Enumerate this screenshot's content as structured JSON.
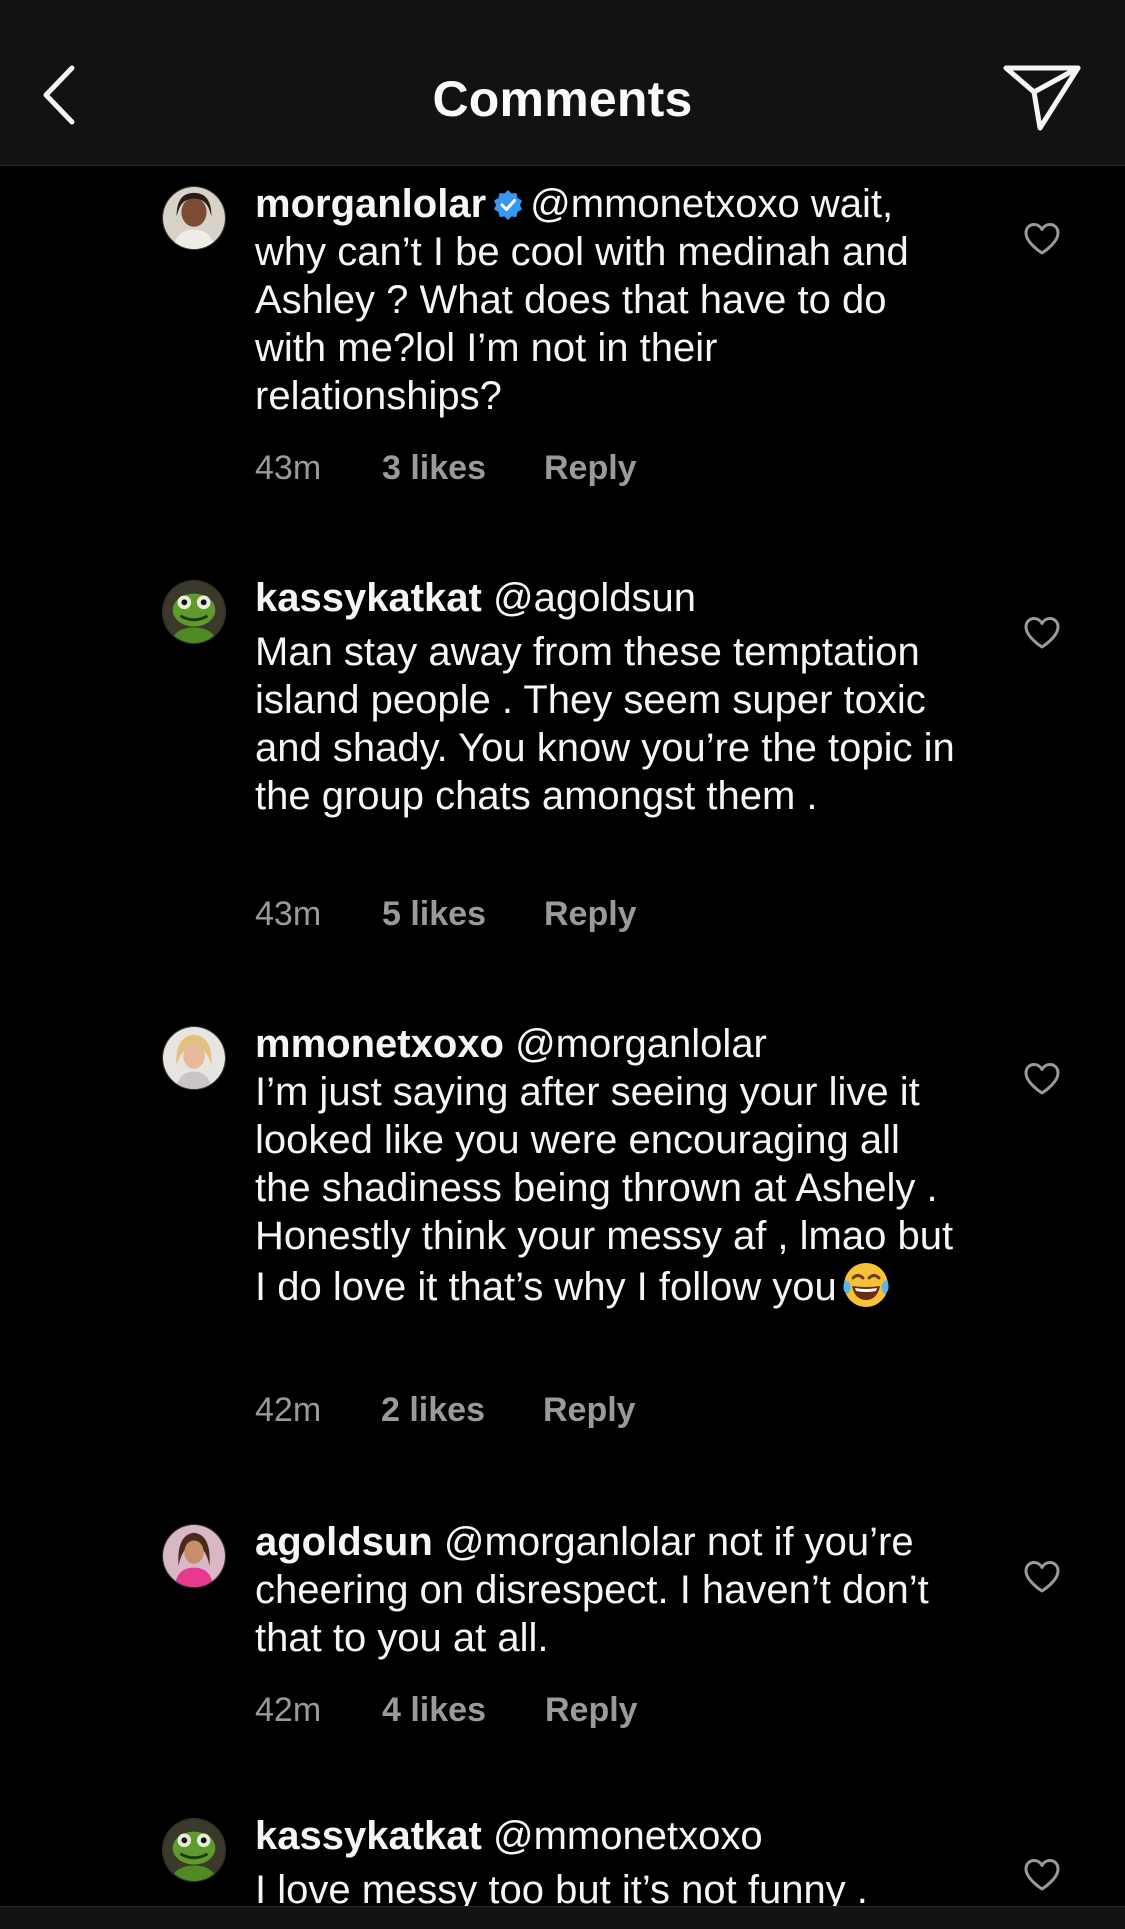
{
  "header": {
    "title": "Comments",
    "back_icon": "chevron-left-icon",
    "share_icon": "send-icon"
  },
  "comments": [
    {
      "username": "morganlolar",
      "verified": true,
      "mention": "@mmonetxoxo",
      "text": " wait, why can’t I be cool with medinah and Ashley ? What does that have to do with me?lol I’m not in their relationships?",
      "time": "43m",
      "likes": "3 likes",
      "reply": "Reply"
    },
    {
      "username": "kassykatkat",
      "mention": "@agoldsun",
      "text": "Man stay away from these temptation island people . They seem super toxic and shady.  You know you’re the topic in the group chats amongst them .",
      "time": "43m",
      "likes": "5 likes",
      "reply": "Reply"
    },
    {
      "username": "mmonetxoxo",
      "mention": "@morganlolar",
      "text": "I’m just saying after seeing your live it looked like you were encouraging all the shadiness being thrown at Ashely . Honestly think your messy af , lmao but I do love it that’s why I follow you",
      "emoji": "face-with-tears-of-joy",
      "time": "42m",
      "likes": "2 likes",
      "reply": "Reply"
    },
    {
      "username": "agoldsun",
      "mention": "@morganlolar",
      "text": " not if you’re cheering on disrespect. I haven’t don’t that to you at all.",
      "time": "42m",
      "likes": "4 likes",
      "reply": "Reply"
    },
    {
      "username": "kassykatkat",
      "mention": "@mmonetxoxo",
      "text": "I love messy too but it’s not funny .",
      "time": "",
      "likes": "",
      "reply": ""
    }
  ],
  "colors": {
    "background": "#000000",
    "header_bg": "#121212",
    "text": "#f5f5f5",
    "meta": "#9a9a9a",
    "verified": "#3897f0"
  },
  "icons": {
    "like": "heart-outline-icon",
    "verified": "verified-badge-icon"
  }
}
